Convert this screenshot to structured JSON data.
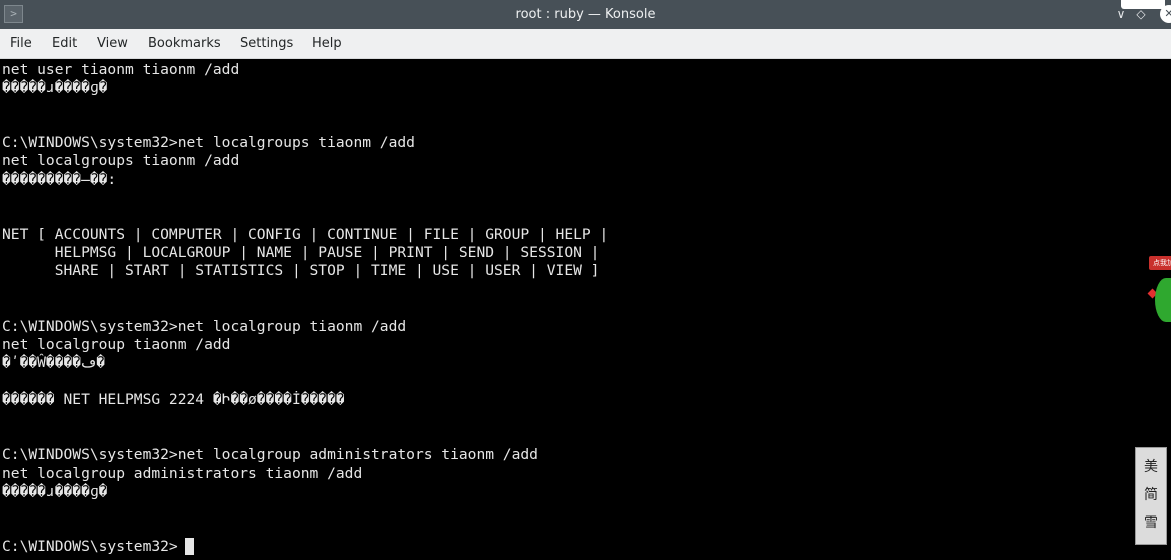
{
  "window": {
    "title": "root : ruby — Konsole",
    "app_icon": ">",
    "minimize_glyph": "∨",
    "maximize_glyph": "◇",
    "close_glyph": "✕"
  },
  "menu": {
    "items": [
      "File",
      "Edit",
      "View",
      "Bookmarks",
      "Settings",
      "Help"
    ]
  },
  "terminal": {
    "lines": [
      "net user tiaonm tiaonm /add",
      "�����ɹ����ɡ�",
      "",
      "",
      "C:\\WINDOWS\\system32>net localgroups tiaonm /add",
      "net localgroups tiaonm /add",
      "���������̶��:",
      "",
      "",
      "NET [ ACCOUNTS | COMPUTER | CONFIG | CONTINUE | FILE | GROUP | HELP |",
      "      HELPMSG | LOCALGROUP | NAME | PAUSE | PRINT | SEND | SESSION |",
      "      SHARE | START | STATISTICS | STOP | TIME | USE | USER | VIEW ]",
      "",
      "",
      "C:\\WINDOWS\\system32>net localgroup tiaonm /add",
      "net localgroup tiaonm /add",
      "�ʹ��Ŵ����ڡ�",
      "",
      "������ NET HELPMSG 2224 �Ի��ø����İ�����",
      "",
      "",
      "C:\\WINDOWS\\system32>net localgroup administrators tiaonm /add",
      "net localgroup administrators tiaonm /add",
      "�����ɹ����ɡ�",
      "",
      "",
      "C:\\WINDOWS\\system32>"
    ]
  },
  "side_widget": {
    "label": "点我加"
  },
  "side_banner": {
    "glyphs": [
      "美",
      "简",
      "雪"
    ]
  },
  "colors": {
    "titlebar": "#475057",
    "menubar": "#eff0f1",
    "terminal_bg": "#000000",
    "terminal_fg": "#e6e6e6"
  }
}
